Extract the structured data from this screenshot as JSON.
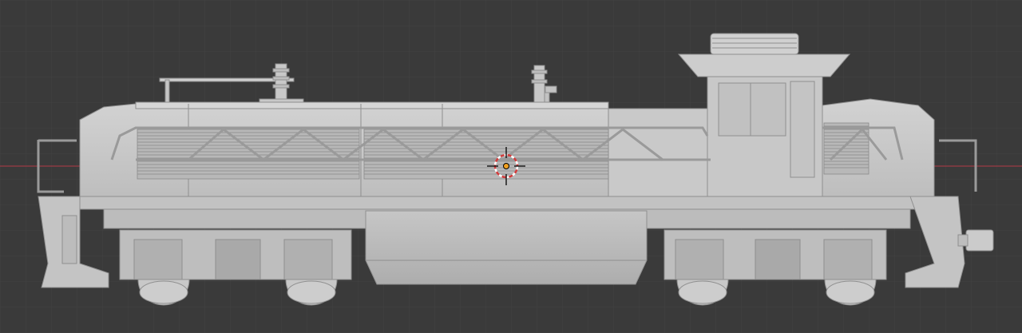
{
  "viewport": {
    "background": "#3a3a3a",
    "grid_minor": "#434343",
    "grid_major": "#4a4a4a",
    "x_axis_color": "#9c3a44",
    "z_axis_color": "#3d73b8",
    "model_color": "#c9c9c9",
    "icons": {
      "cursor": "3d-cursor-icon",
      "origin": "object-origin-icon"
    }
  }
}
